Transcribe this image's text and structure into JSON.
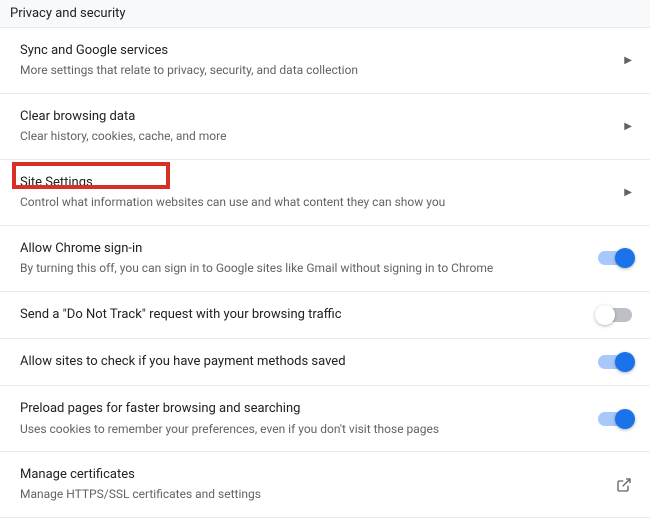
{
  "section_header": "Privacy and security",
  "rows": {
    "sync": {
      "title": "Sync and Google services",
      "subtitle": "More settings that relate to privacy, security, and data collection"
    },
    "clear_data": {
      "title": "Clear browsing data",
      "subtitle": "Clear history, cookies, cache, and more"
    },
    "site_settings": {
      "title": "Site Settings",
      "subtitle": "Control what information websites can use and what content they can show you"
    },
    "chrome_signin": {
      "title": "Allow Chrome sign-in",
      "subtitle": "By turning this off, you can sign in to Google sites like Gmail without signing in to Chrome",
      "enabled": true
    },
    "do_not_track": {
      "title": "Send a \"Do Not Track\" request with your browsing traffic",
      "enabled": false
    },
    "payment_methods": {
      "title": "Allow sites to check if you have payment methods saved",
      "enabled": true
    },
    "preload": {
      "title": "Preload pages for faster browsing and searching",
      "subtitle": "Uses cookies to remember your preferences, even if you don't visit those pages",
      "enabled": true
    },
    "certificates": {
      "title": "Manage certificates",
      "subtitle": "Manage HTTPS/SSL certificates and settings"
    }
  },
  "highlight": "site_settings"
}
